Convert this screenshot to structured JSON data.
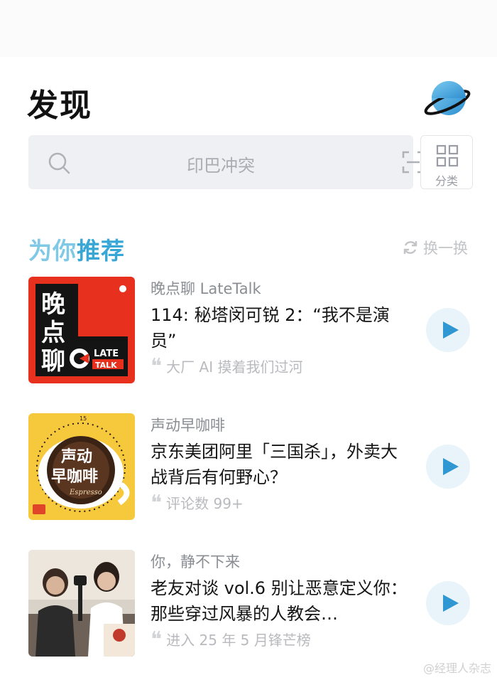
{
  "header": {
    "title": "发现"
  },
  "search": {
    "placeholder_text": "印巴冲突"
  },
  "category_button": {
    "label": "分类"
  },
  "section": {
    "title_part1": "为你",
    "title_part2": "推荐",
    "refresh_label": "换一换"
  },
  "recommendations": [
    {
      "podcast": "晚点聊 LateTalk",
      "episode": "114: 秘塔闵可锐 2：“我不是演员”",
      "extra": "大厂 AI 摸着我们过河",
      "cover": {
        "chars": [
          "晚",
          "点",
          "聊"
        ],
        "badge_top": "LATE",
        "badge_bottom": "TALK",
        "bg": "#e8301f",
        "inner": "#111111"
      }
    },
    {
      "podcast": "声动早咖啡",
      "episode": "京东美团阿里「三国杀」，外卖大战背后有何野心？",
      "extra": "评论数 99+",
      "cover": {
        "line1": "声动",
        "line2": "早咖啡",
        "script": "Espresso",
        "tick": "15",
        "bg": "#f6c93c"
      }
    },
    {
      "podcast": "你，静不下来",
      "episode": "老友对谈 vol.6 别让恶意定义你：那些穿过风暴的人教会…",
      "extra": "进入 25 年 5 月锋芒榜",
      "cover": {
        "bg": "#d9d2c8"
      }
    }
  ],
  "watermark": "@经理人杂志",
  "colors": {
    "accent": "#38a7d5",
    "accent_light": "#7fc9e6",
    "play_bg": "#e8f4fa"
  }
}
